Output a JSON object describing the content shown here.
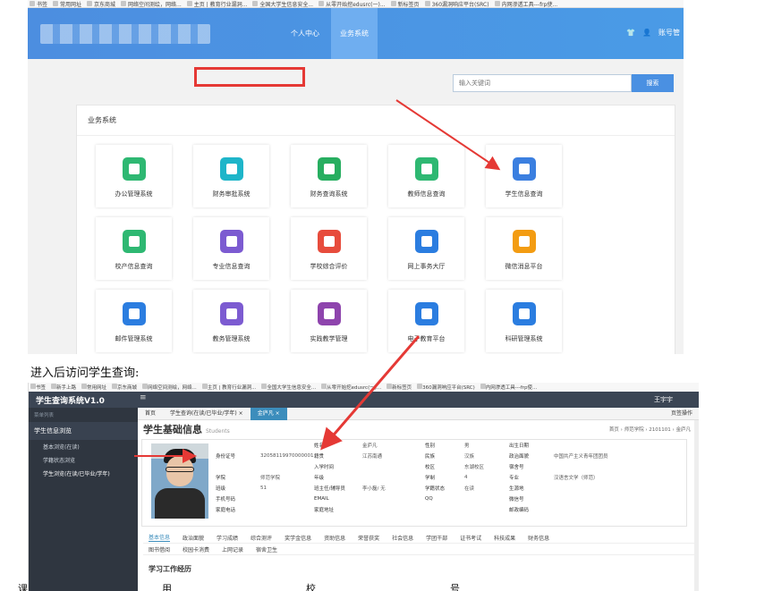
{
  "top": {
    "bookmarks": [
      "书签",
      "常用网址",
      "京东商城",
      "网络空间测绘，网络...",
      "主页 | 教育行业漏洞...",
      "全国大学生信息安全...",
      "从零开始挖edusrc(一)...",
      "新标签页",
      "360漏洞响应平台(SRC)",
      "内网渗透工具---frp使..."
    ],
    "nav": {
      "personal": "个人中心",
      "business": "业务系统",
      "account": "账号管"
    },
    "search": {
      "placeholder": "输入关键词",
      "button": "搜索"
    },
    "panel_title": "业务系统",
    "tiles": [
      {
        "label": "办公管理系统",
        "color": "#2eb872",
        "icon": "document-icon"
      },
      {
        "label": "财务审批系统",
        "color": "#1eb5c9",
        "icon": "money-bag-icon"
      },
      {
        "label": "财务查询系统",
        "color": "#27ae60",
        "icon": "finance-query-icon"
      },
      {
        "label": "教师信息查询",
        "color": "#2eb872",
        "icon": "teacher-icon"
      },
      {
        "label": "学生信息查询",
        "color": "#3b7fe0",
        "icon": "student-icon"
      },
      {
        "label": "校产信息查询",
        "color": "#2eb872",
        "icon": "asset-book-icon"
      },
      {
        "label": "专业信息查询",
        "color": "#7c5bd1",
        "icon": "books-icon"
      },
      {
        "label": "学校综合评价",
        "color": "#e74c3c",
        "icon": "thumbs-up-icon"
      },
      {
        "label": "网上事务大厅",
        "color": "#2b7de0",
        "icon": "grid-icon"
      },
      {
        "label": "微信消息平台",
        "color": "#f39c12",
        "icon": "speaker-icon"
      },
      {
        "label": "邮件管理系统",
        "color": "#2b7de0",
        "icon": "mail-icon"
      },
      {
        "label": "教务管理系统",
        "color": "#7c5bd1",
        "icon": "teaching-icon"
      },
      {
        "label": "实践教学管理",
        "color": "#8e44ad",
        "icon": "video-icon"
      },
      {
        "label": "电子教育平台",
        "color": "#2b7de0",
        "icon": "stack-icon"
      },
      {
        "label": "科研管理系统",
        "color": "#2b7de0",
        "icon": "flask-icon"
      }
    ]
  },
  "caption": "进入后访问学生查询:",
  "bottom": {
    "bookmarks": [
      "书签",
      "新手上路",
      "常用网址",
      "京东商城",
      "网络空间测绘，网络...",
      "主页 | 教育行业漏洞...",
      "全国大学生信息安全...",
      "从零开始挖edusrc(一)...",
      "新标签页",
      "360漏洞响应平台(SRC)",
      "内网渗透工具---frp使..."
    ],
    "app_title": "学生查询系统V1.0",
    "menu_icon": "≡",
    "user": "王宇宇",
    "sidebar": {
      "head": "菜单列表",
      "group": "学生信息浏览",
      "items": [
        "基本浏览(在读)",
        "学籍状态浏览",
        "学生浏览(在读/已毕业/学年)"
      ]
    },
    "tabs_top": [
      "首页",
      "学生查询(在读/已毕业/学年) ×",
      "金庐凡 ×"
    ],
    "tabs_right": "页签操作",
    "page_title": "学生基础信息",
    "page_subtitle": "Students",
    "crumbs": "首页 › 师范学院 › 2101101 › 金庐凡",
    "info": [
      [
        "",
        "",
        "姓名",
        "金庐凡",
        "性别",
        "男",
        "出生日期",
        ""
      ],
      [
        "身份证号",
        "32058119970000001X",
        "籍贯",
        "江苏南通",
        "民族",
        "汉族",
        "政治面貌",
        "中国共产主义青年团团员"
      ],
      [
        "",
        "",
        "入学时间",
        "",
        "校区",
        "东湖校区",
        "宿舍号",
        ""
      ],
      [
        "学院",
        "师范学院",
        "年级",
        "",
        "学制",
        "4",
        "专业",
        "汉语言文学（师范）"
      ],
      [
        "班级",
        "51",
        "班主任/辅导员",
        "李小磊/ 无",
        "学籍状态",
        "在读",
        "生源地",
        ""
      ],
      [
        "手机号码",
        "",
        "EMAIL",
        "",
        "QQ",
        "",
        "微信号",
        ""
      ],
      [
        "家庭电话",
        "",
        "家庭地址",
        "",
        "",
        "",
        "邮政编码",
        ""
      ]
    ],
    "detail_tabs_1": [
      "基本信息",
      "政治面貌",
      "学习成绩",
      "综合测评",
      "奖学金信息",
      "资助信息",
      "荣誉获奖",
      "社会信息",
      "学团干部",
      "证书考试",
      "科技成果",
      "财务信息"
    ],
    "detail_tabs_2": [
      "图书借阅",
      "校园卡消费",
      "上网记录",
      "宿舍卫生"
    ],
    "section": "学习工作经历"
  },
  "footer": [
    "课",
    "用",
    "校",
    "号"
  ],
  "colors": {
    "arrow": "#e53935",
    "brand": "#4a90e2"
  }
}
